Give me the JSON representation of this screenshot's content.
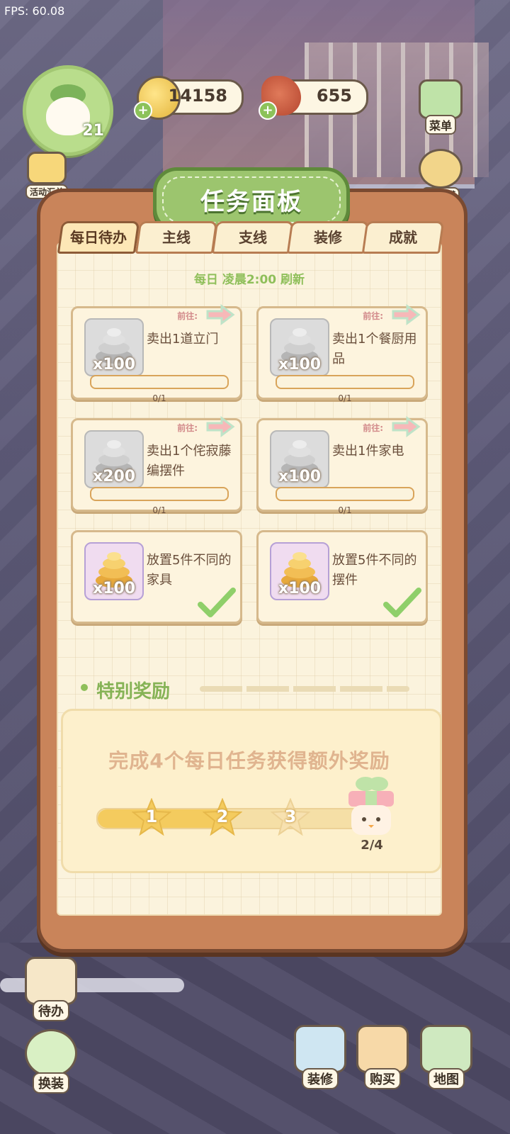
{
  "fps": "FPS: 60.08",
  "player": {
    "level": "21"
  },
  "resources": {
    "coins": "14158",
    "meat": "655"
  },
  "side_buttons": {
    "events": "活动汇总",
    "menu": "菜单",
    "piggy": "存钱罐"
  },
  "panel": {
    "title": "任务面板",
    "tabs": [
      "每日待办",
      "主线",
      "支线",
      "装修",
      "成就"
    ],
    "refresh_note": "每日 凌晨2:00 刷新",
    "goto_label": "前往:",
    "tasks": [
      {
        "qty": "x100",
        "desc": "卖出1道立门",
        "progress": "0/1",
        "reward_type": "silver",
        "done": false
      },
      {
        "qty": "x100",
        "desc": "卖出1个餐厨用品",
        "progress": "0/1",
        "reward_type": "silver",
        "done": false
      },
      {
        "qty": "x200",
        "desc": "卖出1个侘寂藤编摆件",
        "progress": "0/1",
        "reward_type": "silver",
        "done": false
      },
      {
        "qty": "x100",
        "desc": "卖出1件家电",
        "progress": "0/1",
        "reward_type": "silver",
        "done": false
      },
      {
        "qty": "x100",
        "desc": "放置5件不同的家具",
        "progress": "",
        "reward_type": "gold",
        "done": true
      },
      {
        "qty": "x100",
        "desc": "放置5件不同的摆件",
        "progress": "",
        "reward_type": "gold",
        "done": true
      }
    ],
    "special": {
      "title": "特别奖励",
      "description": "完成4个每日任务获得额外奖励",
      "stars": [
        "1",
        "2",
        "3"
      ],
      "count": "2/4",
      "progress_fraction": 0.5
    }
  },
  "bottom_buttons": {
    "todo": "待办",
    "dress": "换装",
    "decorate": "装修",
    "shop": "购买",
    "map": "地图"
  },
  "colors": {
    "panel": "#c9845a",
    "paper": "#fbf3dd",
    "title": "#9cc56e",
    "accent_green": "#8fbf5a",
    "progress": "#f4cb5e"
  }
}
